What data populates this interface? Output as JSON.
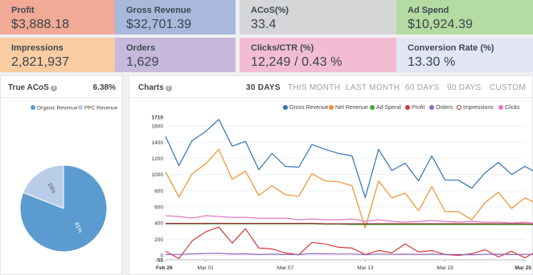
{
  "kpis": {
    "profit": {
      "label": "Profit",
      "value": "$3,888.18"
    },
    "gross": {
      "label": "Gross Revenue",
      "value": "$32,701.39"
    },
    "acos": {
      "label": "ACoS(%)",
      "value": "33.4"
    },
    "adspend": {
      "label": "Ad Spend",
      "value": "$10,924.39"
    },
    "impressions": {
      "label": "Impressions",
      "value": "2,821,937"
    },
    "orders": {
      "label": "Orders",
      "value": "1,629"
    },
    "clicks": {
      "label": "Clicks/CTR (%)",
      "value": "12,249 / 0.43 %"
    },
    "conversion": {
      "label": "Conversion Rate (%)",
      "value": "13.30 %"
    }
  },
  "true_acos": {
    "title": "True ACoS",
    "value": "6.38%",
    "legend": [
      {
        "label": "Organic Revenue",
        "color": "#5b9bd0"
      },
      {
        "label": "PPC Revenue",
        "color": "#b9cde9"
      }
    ],
    "pie_labels": [
      "81%",
      "19%"
    ],
    "pie_values": [
      81,
      19
    ]
  },
  "charts": {
    "title": "Charts",
    "ranges": [
      "30 DAYS",
      "THIS MONTH",
      "LAST MONTH",
      "60 DAYS",
      "90 DAYS",
      "CUSTOM"
    ],
    "active_range": "30 DAYS"
  },
  "chart_data": {
    "type": "line",
    "legend": [
      "Gross Revenue",
      "Net Revenue",
      "Ad Spend",
      "Profit",
      "Orders",
      "Impressions",
      "Clicks"
    ],
    "y_ticks": [
      "1710",
      "1600",
      "1400",
      "1200",
      "1000",
      "800",
      "600",
      "400",
      "200",
      "0",
      "-55"
    ],
    "x_ticks": [
      "Feb 26",
      "Mar 01",
      "Mar 07",
      "Mar 13",
      "Mar 19",
      "Mar 25"
    ],
    "ylim": [
      -55,
      1710
    ],
    "x": [
      "Feb 26",
      "Feb 27",
      "Feb 28",
      "Mar 01",
      "Mar 02",
      "Mar 03",
      "Mar 04",
      "Mar 05",
      "Mar 06",
      "Mar 07",
      "Mar 08",
      "Mar 09",
      "Mar 10",
      "Mar 11",
      "Mar 12",
      "Mar 13",
      "Mar 14",
      "Mar 15",
      "Mar 16",
      "Mar 17",
      "Mar 18",
      "Mar 19",
      "Mar 20",
      "Mar 21",
      "Mar 22",
      "Mar 23",
      "Mar 24",
      "Mar 25"
    ],
    "series": [
      {
        "name": "Gross Revenue",
        "color": "#2f73b5",
        "values": [
          1470,
          1110,
          1420,
          1530,
          1680,
          1350,
          1410,
          1060,
          1260,
          1100,
          1090,
          1370,
          1310,
          1260,
          1230,
          715,
          1310,
          1050,
          1140,
          920,
          1230,
          930,
          930,
          830,
          1020,
          1150,
          1000,
          1100,
          1010
        ]
      },
      {
        "name": "Net Revenue",
        "color": "#f28f2c",
        "values": [
          1030,
          720,
          1010,
          1130,
          1310,
          940,
          1040,
          740,
          860,
          750,
          730,
          1010,
          920,
          910,
          860,
          340,
          920,
          710,
          770,
          550,
          850,
          540,
          540,
          440,
          650,
          780,
          580,
          710,
          630
        ]
      },
      {
        "name": "Ad Spend",
        "color": "#3ea83f",
        "values": [
          390,
          390,
          390,
          390,
          390,
          390,
          390,
          390,
          390,
          390,
          390,
          390,
          385,
          385,
          380,
          380,
          380,
          380,
          380,
          380,
          380,
          380,
          380,
          380,
          380,
          380,
          380,
          380,
          380
        ]
      },
      {
        "name": "Profit",
        "color": "#d93636",
        "values": [
          50,
          -40,
          180,
          290,
          350,
          150,
          330,
          90,
          80,
          30,
          5,
          160,
          140,
          100,
          90,
          10,
          60,
          30,
          140,
          40,
          60,
          10,
          0,
          20,
          70,
          -20,
          50,
          -30,
          60
        ]
      },
      {
        "name": "Orders",
        "color": "#9467bd",
        "values": [
          10,
          12,
          18,
          22,
          25,
          15,
          18,
          10,
          15,
          10,
          10,
          20,
          18,
          16,
          16,
          8,
          16,
          12,
          14,
          10,
          14,
          10,
          10,
          8,
          12,
          14,
          10,
          12,
          10
        ]
      },
      {
        "name": "Impressions",
        "color": "#9a3434",
        "values": [
          395,
          395,
          395,
          395,
          395,
          395,
          395,
          395,
          395,
          395,
          395,
          395,
          390,
          390,
          390,
          390,
          390,
          390,
          390,
          390,
          390,
          390,
          390,
          390,
          390,
          390,
          390,
          390,
          385
        ]
      },
      {
        "name": "Clicks",
        "color": "#e377c2",
        "values": [
          490,
          480,
          460,
          490,
          480,
          470,
          470,
          460,
          460,
          460,
          440,
          450,
          440,
          440,
          450,
          420,
          440,
          420,
          410,
          420,
          430,
          420,
          410,
          420,
          410,
          410,
          400,
          410,
          390
        ]
      }
    ]
  }
}
